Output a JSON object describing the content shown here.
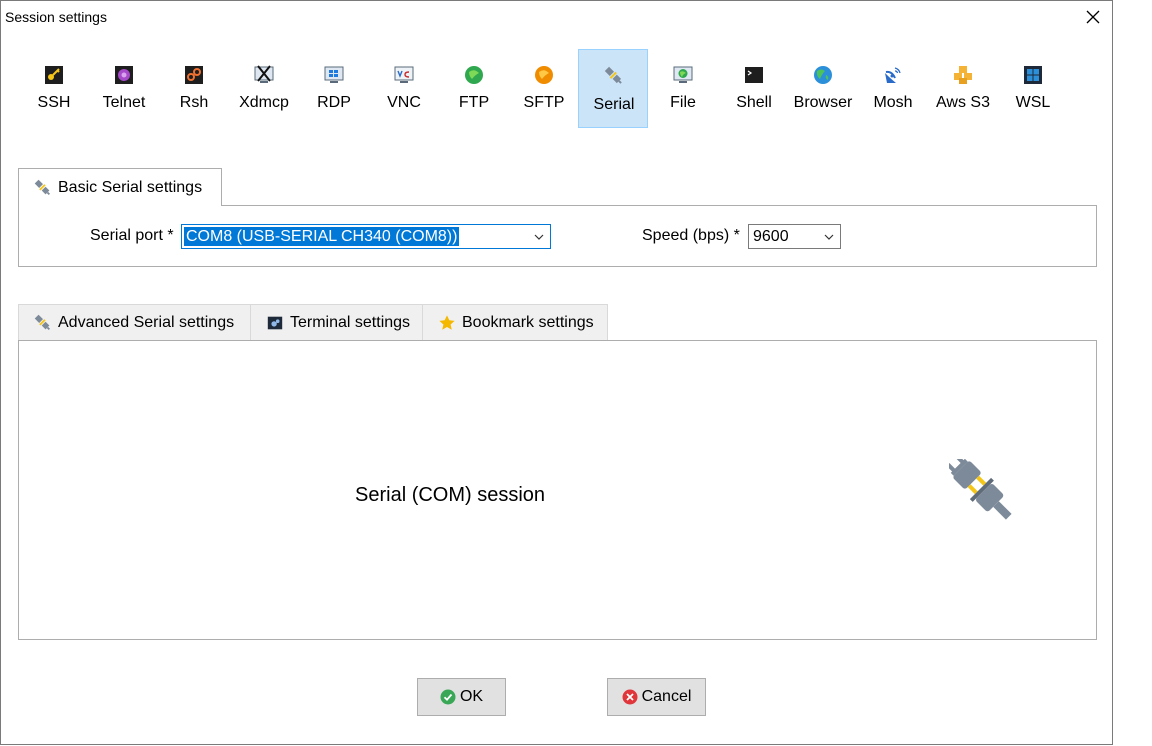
{
  "window": {
    "title": "Session settings"
  },
  "toolbar": {
    "protocols": [
      {
        "label": "SSH",
        "icon": "key-icon"
      },
      {
        "label": "Telnet",
        "icon": "telnet-icon"
      },
      {
        "label": "Rsh",
        "icon": "rsh-icon"
      },
      {
        "label": "Xdmcp",
        "icon": "xdmcp-icon"
      },
      {
        "label": "RDP",
        "icon": "rdp-icon"
      },
      {
        "label": "VNC",
        "icon": "vnc-icon"
      },
      {
        "label": "FTP",
        "icon": "ftp-icon"
      },
      {
        "label": "SFTP",
        "icon": "sftp-icon"
      },
      {
        "label": "Serial",
        "icon": "plug-icon",
        "selected": true
      },
      {
        "label": "File",
        "icon": "file-icon"
      },
      {
        "label": "Shell",
        "icon": "terminal-icon"
      },
      {
        "label": "Browser",
        "icon": "globe-icon"
      },
      {
        "label": "Mosh",
        "icon": "satellite-icon"
      },
      {
        "label": "Aws S3",
        "icon": "aws-cubes-icon"
      },
      {
        "label": "WSL",
        "icon": "windows-icon"
      }
    ]
  },
  "basic": {
    "tab_label": "Basic Serial settings",
    "serial_port_label": "Serial port *",
    "serial_port_value": "COM8  (USB-SERIAL CH340 (COM8))",
    "speed_label": "Speed (bps) *",
    "speed_value": "9600"
  },
  "advanced_tabs": [
    {
      "label": "Advanced Serial settings",
      "icon": "plug-icon"
    },
    {
      "label": "Terminal settings",
      "icon": "terminal-settings-icon"
    },
    {
      "label": "Bookmark settings",
      "icon": "star-icon"
    }
  ],
  "session_text": "Serial (COM) session",
  "buttons": {
    "ok": "OK",
    "cancel": "Cancel"
  },
  "colors": {
    "selected_bg": "#cce4f7",
    "selected_border": "#99d1ff",
    "focus_blue": "#0078d7",
    "ok_green": "#3aa757",
    "cancel_red": "#e0353a"
  }
}
